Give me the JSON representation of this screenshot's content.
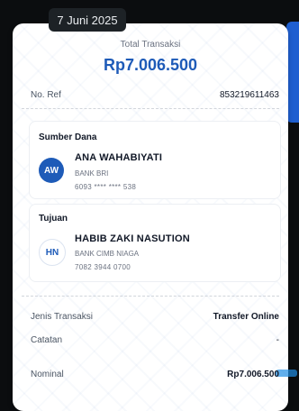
{
  "date_pill": "7 Juni 2025",
  "total": {
    "label": "Total Transaksi",
    "amount": "Rp7.006.500"
  },
  "ref": {
    "label": "No. Ref",
    "value": "853219611463"
  },
  "source": {
    "title": "Sumber Dana",
    "initials": "AW",
    "name": "ANA WAHABIYATI",
    "bank": "BANK BRI",
    "account": "6093 **** **** 538"
  },
  "destination": {
    "title": "Tujuan",
    "initials": "HN",
    "name": "HABIB ZAKI NASUTION",
    "bank": "BANK CIMB NIAGA",
    "account": "7082 3944 0700"
  },
  "details": [
    {
      "label": "Jenis Transaksi",
      "value": "Transfer Online"
    },
    {
      "label": "Catatan",
      "value": "-"
    },
    {
      "label": "Nominal",
      "value": "Rp7.006.500"
    }
  ],
  "colors": {
    "brand_blue": "#1e5bb8",
    "accent_blue": "#1f5fd0"
  }
}
